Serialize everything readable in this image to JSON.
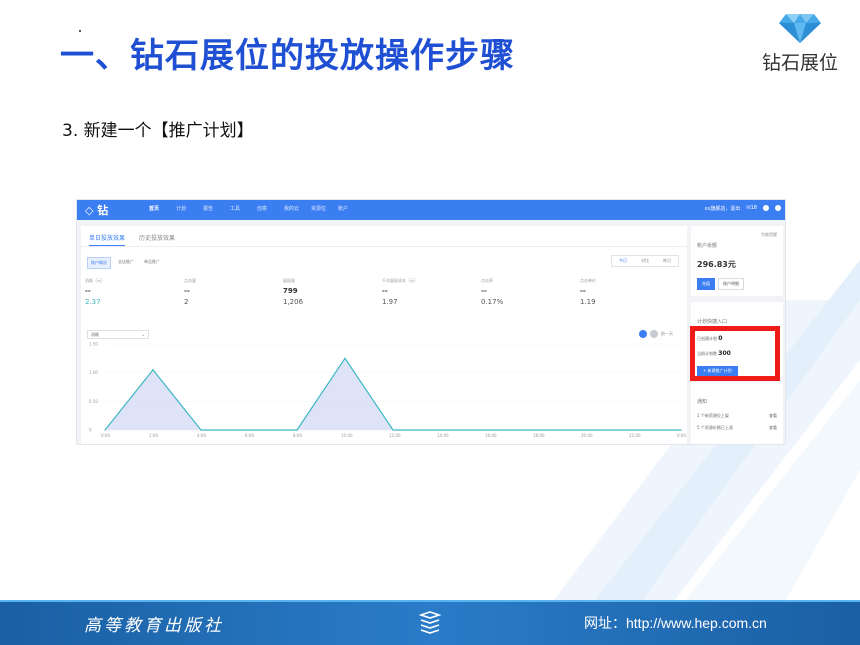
{
  "slide": {
    "title": "一、钻石展位的投放操作步骤",
    "logo_text": "钻石展位",
    "step": "3. 新建一个【推广计划】"
  },
  "app": {
    "brand": "◇ 钻",
    "nav": [
      "首页",
      "计划",
      "报告",
      "工具",
      "创意",
      "我的云",
      "资源位",
      "账户"
    ],
    "top_right": {
      "user": "xx旗舰店，退出",
      "mail": "✉18"
    },
    "tabs": [
      "单日投放效果",
      "历史投放效果"
    ],
    "subtabs": [
      "账户概况",
      "全店推广",
      "单品推广"
    ],
    "date_filter": [
      "今日",
      "对比",
      "昨日"
    ],
    "metrics": [
      {
        "label": "消耗（元）",
        "value": "--",
        "compare": "2.37"
      },
      {
        "label": "点击量",
        "value": "--",
        "compare": "2"
      },
      {
        "label": "展现量",
        "value": "799",
        "compare": "1,206"
      },
      {
        "label": "千次展现成本（元）",
        "value": "--",
        "compare": "1.97"
      },
      {
        "label": "点击率",
        "value": "--",
        "compare": "0.17%"
      },
      {
        "label": "点击单价",
        "value": "--",
        "compare": "1.19"
      }
    ],
    "chart_select": "消耗",
    "chart_legend": "前一天",
    "sidebar": {
      "account_title": "账户余额",
      "account_link": "余额提醒",
      "balance": "296.83元",
      "btn_recharge": "充值",
      "btn_detail": "账户明细",
      "quick_title": "计划快捷入口",
      "quick_row1_label": "已创建计划",
      "quick_row1_value": "0",
      "quick_row2_label": "当前计划数",
      "quick_row2_value": "300",
      "new_plan_btn": "+ 新建推广计划",
      "notice_title": "通知",
      "notices": [
        "1 个新资源位上架",
        "5 个资源价格已上涨"
      ],
      "notice_link": "查看"
    }
  },
  "chart_data": {
    "type": "area",
    "x": [
      "0:00",
      "2:00",
      "4:00",
      "6:00",
      "8:00",
      "10:00",
      "12:00",
      "14:00",
      "16:00",
      "18:00",
      "20:00",
      "22:00",
      "0:00"
    ],
    "tick_labels_y": [
      "0",
      "0.50",
      "1.00",
      "1.50"
    ],
    "ylim": [
      0,
      1.5
    ],
    "series": [
      {
        "values": [
          0,
          1.05,
          0,
          0,
          0,
          1.25,
          0,
          0,
          0,
          0,
          0,
          0,
          0
        ],
        "color": "#3bb7c4"
      }
    ]
  },
  "footer": {
    "publisher": "高等教育出版社",
    "website": "网址：http://www.hep.com.cn"
  },
  "colors": {
    "title_blue": "#1f4fd3",
    "app_blue": "#3a7ef2",
    "highlight_red": "#ef1b16",
    "footer_blue": "#1a5fa3"
  }
}
